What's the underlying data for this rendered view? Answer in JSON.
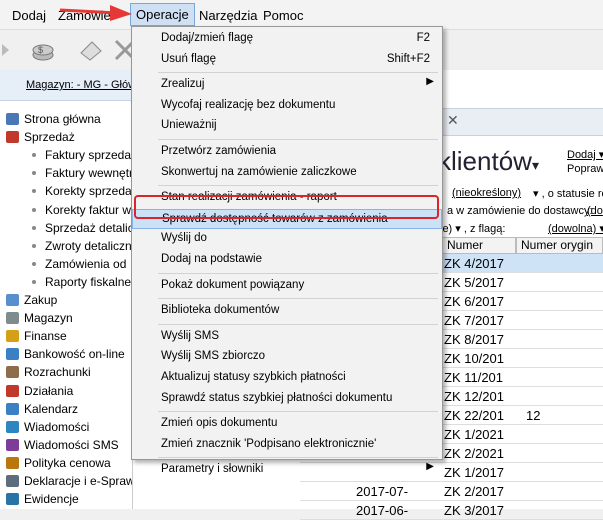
{
  "menubar": {
    "items": [
      "Dodaj",
      "Zamówie",
      "Operacje",
      "Narzędzia",
      "Pomoc"
    ]
  },
  "sidebar": {
    "warehouse": "Magazyn: - MG - Głów",
    "items": [
      {
        "label": "Strona główna",
        "type": "top",
        "icon": "home-icon"
      },
      {
        "label": "Sprzedaż",
        "type": "top",
        "icon": "sales-icon"
      },
      {
        "label": "Faktury sprzedaż",
        "type": "sub"
      },
      {
        "label": "Faktury wewnętrz",
        "type": "sub"
      },
      {
        "label": "Korekty sprzedaż",
        "type": "sub"
      },
      {
        "label": "Korekty faktur w",
        "type": "sub"
      },
      {
        "label": "Sprzedaż detalicz",
        "type": "sub"
      },
      {
        "label": "Zwroty detaliczn",
        "type": "sub"
      },
      {
        "label": "Zamówienia od",
        "type": "sub"
      },
      {
        "label": "Raporty fiskalne",
        "type": "sub"
      },
      {
        "label": "Zakup",
        "type": "top",
        "icon": "purchase-icon"
      },
      {
        "label": "Magazyn",
        "type": "top",
        "icon": "warehouse-icon"
      },
      {
        "label": "Finanse",
        "type": "top",
        "icon": "finance-icon"
      },
      {
        "label": "Bankowość on-line",
        "type": "top",
        "icon": "bank-icon"
      },
      {
        "label": "Rozrachunki",
        "type": "top",
        "icon": "settlements-icon"
      },
      {
        "label": "Działania",
        "type": "top",
        "icon": "actions-icon"
      },
      {
        "label": "Kalendarz",
        "type": "top",
        "icon": "calendar-icon"
      },
      {
        "label": "Wiadomości",
        "type": "top",
        "icon": "messages-icon"
      },
      {
        "label": "Wiadomości SMS",
        "type": "top",
        "icon": "sms-icon"
      },
      {
        "label": "Polityka cenowa",
        "type": "top",
        "icon": "pricing-icon"
      },
      {
        "label": "Deklaracje i e-Sprawozdawczość",
        "type": "top",
        "icon": "declarations-icon"
      },
      {
        "label": "Ewidencje",
        "type": "top",
        "icon": "records-icon"
      }
    ]
  },
  "content": {
    "title": "l klientów",
    "title_arrow": "▾",
    "tab_close": "✕",
    "link_dodaj": "Dodaj ▾",
    "link_poprawa": "Popraw",
    "filter1_link": "(nieokreślony)",
    "filter1_text": "▾ , o statusie rea",
    "filter2_text": "a w zamówienie do dostawcy:",
    "filter2_link": "(do",
    "filter3_prefix": "ie) ▾ , z flagą:",
    "filter3_link": "(dowolna) ▾",
    "columns": [
      "Numer",
      "Numer orygin"
    ],
    "rows": [
      {
        "date": "",
        "number": "ZK 4/2017",
        "orig": ""
      },
      {
        "date": "",
        "number": "ZK 5/2017",
        "orig": ""
      },
      {
        "date": "",
        "number": "ZK 6/2017",
        "orig": ""
      },
      {
        "date": "",
        "number": "ZK 7/2017",
        "orig": ""
      },
      {
        "date": "",
        "number": "ZK 8/2017",
        "orig": ""
      },
      {
        "date": "",
        "number": "ZK 10/201",
        "orig": ""
      },
      {
        "date": "",
        "number": "ZK 11/201",
        "orig": ""
      },
      {
        "date": "",
        "number": "ZK 12/201",
        "orig": ""
      },
      {
        "date": "",
        "number": "ZK 22/201",
        "orig": "12"
      },
      {
        "date": "",
        "number": "ZK 1/2021",
        "orig": ""
      },
      {
        "date": "",
        "number": "ZK 2/2021",
        "orig": ""
      },
      {
        "date": "",
        "number": "ZK 1/2017",
        "orig": ""
      },
      {
        "date": "2017-07-",
        "number": "ZK 2/2017",
        "orig": ""
      },
      {
        "date": "2017-06-",
        "number": "ZK 3/2017",
        "orig": ""
      }
    ]
  },
  "dropdown": {
    "items": [
      {
        "label": "Dodaj/zmień flagę",
        "shortcut": "F2"
      },
      {
        "label": "Usuń flagę",
        "shortcut": "Shift+F2"
      },
      {
        "sep": true
      },
      {
        "label": "Zrealizuj",
        "submenu": true
      },
      {
        "label": "Wycofaj realizację bez dokumentu"
      },
      {
        "label": "Unieważnij"
      },
      {
        "sep": true
      },
      {
        "label": "Przetwórz zamówienia"
      },
      {
        "label": "Skonwertuj na zamówienie zaliczkowe"
      },
      {
        "sep": true
      },
      {
        "label": "Stan realizacji zamówienia - raport"
      },
      {
        "label": "Sprawdź dostępność towarów z zamówienia",
        "highlighted": true
      },
      {
        "label": "Wyślij do"
      },
      {
        "label": "Dodaj na podstawie"
      },
      {
        "sep": true
      },
      {
        "label": "Pokaż dokument powiązany"
      },
      {
        "sep": true
      },
      {
        "label": "Biblioteka dokumentów"
      },
      {
        "sep": true
      },
      {
        "label": "Wyślij SMS"
      },
      {
        "label": "Wyślij SMS zbiorczo"
      },
      {
        "label": "Aktualizuj statusy szybkich płatności"
      },
      {
        "label": "Sprawdź status szybkiej płatności dokumentu"
      },
      {
        "sep": true
      },
      {
        "label": "Zmień opis dokumentu"
      },
      {
        "label": "Zmień znacznik 'Podpisano elektronicznie'"
      },
      {
        "sep": true
      },
      {
        "label": "Parametry i słowniki",
        "submenu": true
      }
    ]
  },
  "colors": {
    "highlight": "#cce0f6",
    "callout": "#d9252b",
    "selected_row": "#cfe3f7"
  }
}
